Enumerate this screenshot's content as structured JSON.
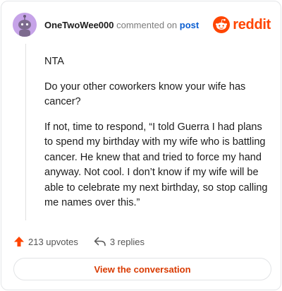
{
  "header": {
    "username": "OneTwoWee000",
    "action_text": "commented on",
    "post_link": "post",
    "logo_text": "reddit"
  },
  "comment": {
    "paragraphs": [
      "NTA",
      "Do your other coworkers know your wife has cancer?",
      "If not, time to respond, “I told Guerra I had plans to spend my birthday with my wife who is battling cancer. He knew that and tried to force my hand anyway. Not cool. I don’t know if my wife will be able to celebrate my next birthday, so stop calling me names over this.”"
    ]
  },
  "actions": {
    "upvotes": "213 upvotes",
    "replies": "3 replies"
  },
  "cta": {
    "label": "View the conversation"
  },
  "colors": {
    "brand": "#ff4500",
    "link": "#0b5ed1",
    "cta_text": "#d93a00",
    "avatar_bg": "#c6a3e8"
  },
  "icons": {
    "avatar": "snoo-avatar-icon",
    "logo": "reddit-snoo-icon",
    "upvote": "upvote-arrow-icon",
    "reply": "reply-arrow-icon"
  }
}
